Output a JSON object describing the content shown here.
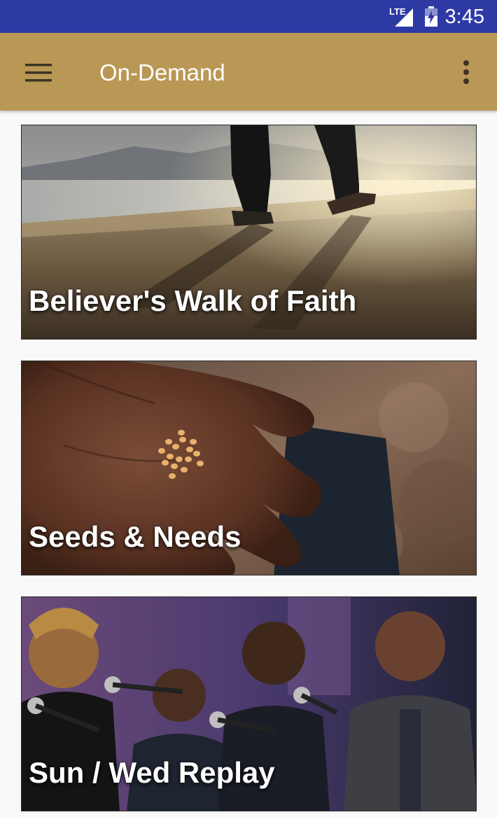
{
  "status_bar": {
    "network": "LTE",
    "time": "3:45",
    "color": "#2e3aa4"
  },
  "app_bar": {
    "title": "On-Demand",
    "menu_icon": "hamburger-menu-icon",
    "overflow_icon": "more-vertical-icon",
    "color": "#b99855"
  },
  "cards": [
    {
      "title": "Believer's Walk of Faith",
      "image": "walking-feet-on-pier-photo"
    },
    {
      "title": "Seeds & Needs",
      "image": "hand-holding-seeds-photo"
    },
    {
      "title": "Sun / Wed Replay",
      "image": "choir-singing-photo"
    }
  ]
}
